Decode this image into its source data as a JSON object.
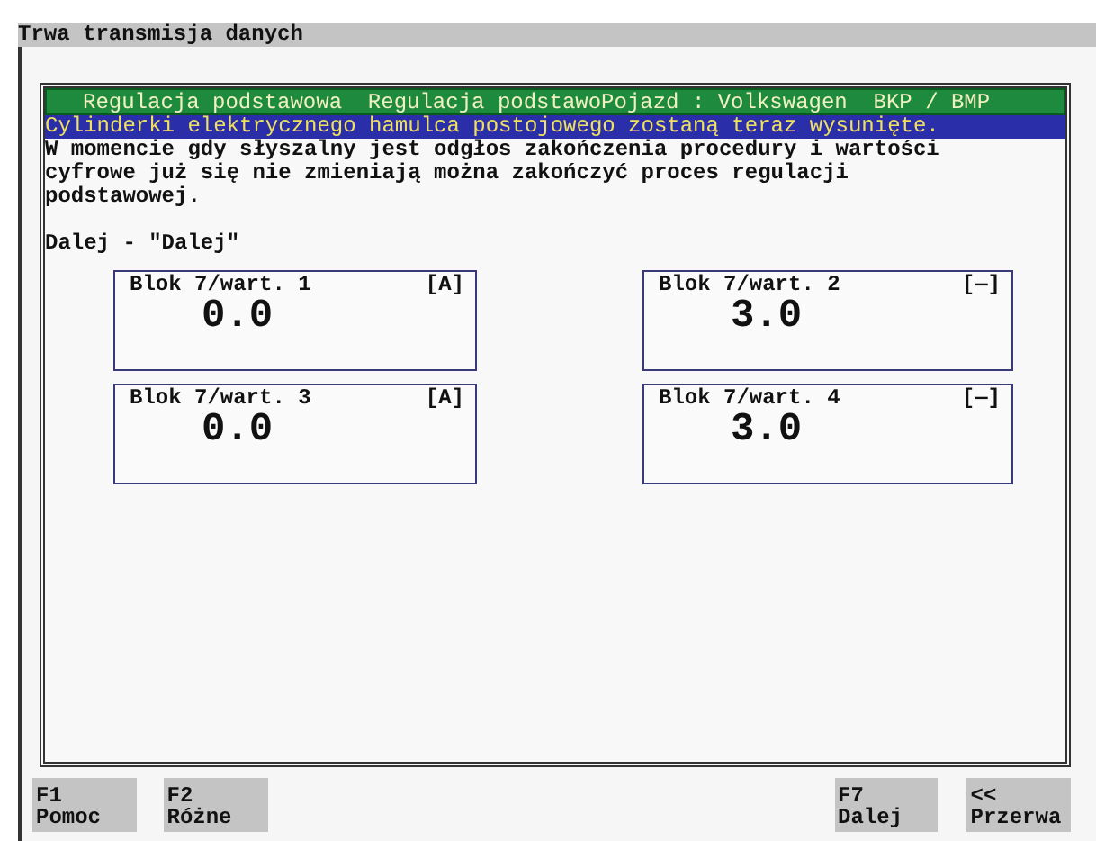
{
  "window": {
    "title": "Trwa transmisja danych"
  },
  "header": "Regulacja podstawowa  Regulacja podstawoPojazd : Volkswagen  BKP / BMP",
  "highlight": "Cylinderki elektrycznego hamulca postojowego zostaną teraz wysunięte.",
  "message": "W momencie gdy słyszalny jest odgłos zakończenia procedury i wartości cyfrowe już się nie zmieniają można zakończyć proces regulacji podstawowej.",
  "prompt": "Dalej - \"Dalej\"",
  "blocks": [
    {
      "label": "Blok 7/wart. 1",
      "unit": "[A]",
      "value": "0.0"
    },
    {
      "label": "Blok 7/wart. 2",
      "unit": "[—]",
      "value": "3.0"
    },
    {
      "label": "Blok 7/wart. 3",
      "unit": "[A]",
      "value": "0.0"
    },
    {
      "label": "Blok 7/wart. 4",
      "unit": "[—]",
      "value": "3.0"
    }
  ],
  "function_keys": [
    {
      "key": "F1",
      "label": "Pomoc"
    },
    {
      "key": "F2",
      "label": "Różne"
    },
    {
      "key": "F7",
      "label": "Dalej"
    },
    {
      "key": "<<",
      "label": "Przerwa"
    }
  ]
}
